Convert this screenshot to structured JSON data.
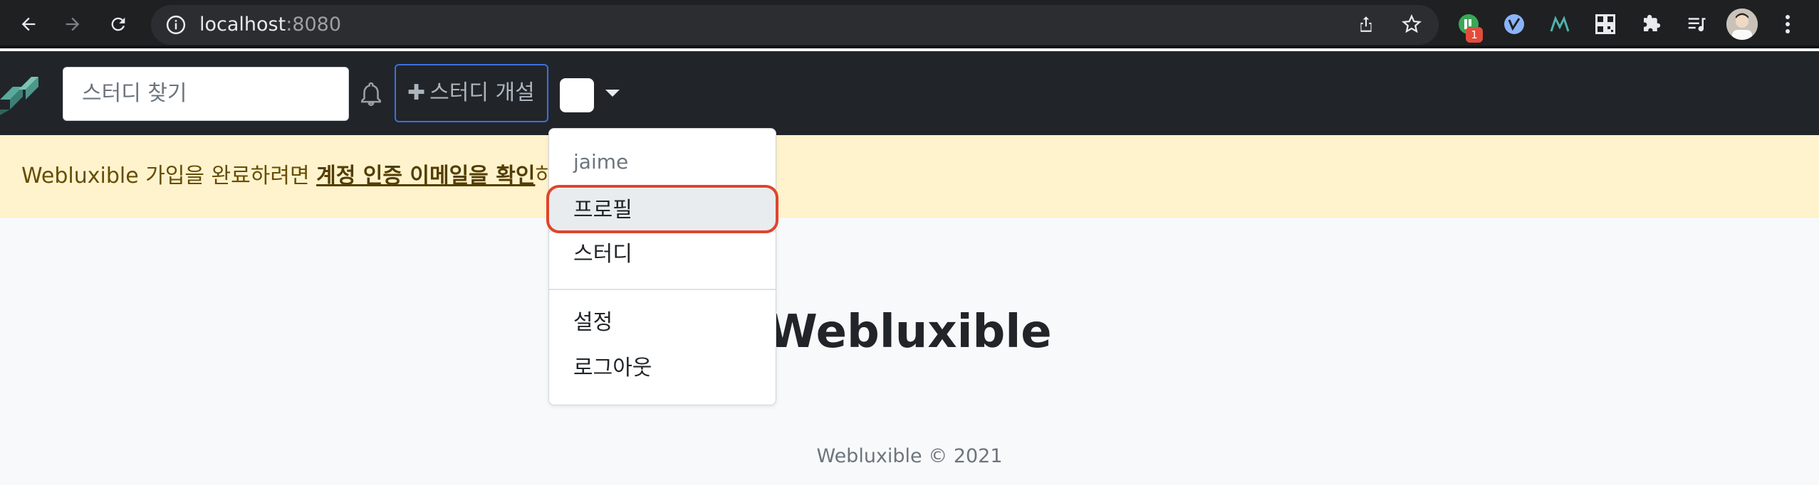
{
  "browser": {
    "url_host": "localhost",
    "url_port": ":8080",
    "extension_badge": "1"
  },
  "navbar": {
    "search_placeholder": "스터디 찾기",
    "open_study_label": "스터디 개설"
  },
  "alert": {
    "prefix": "Webluxible 가입을 완료하려면 ",
    "link": "계정 인증 이메일을 확인",
    "suffix": "하세요."
  },
  "dropdown": {
    "username": "jaime",
    "items": {
      "profile": "프로필",
      "study": "스터디",
      "settings": "설정",
      "logout": "로그아웃"
    }
  },
  "main": {
    "title": "Webluxible"
  },
  "footer": {
    "text": "Webluxible © 2021"
  },
  "colors": {
    "navbar_bg": "#212529",
    "alert_bg": "#fff3cd",
    "highlight": "#e0442c",
    "open_study_border": "#3d6fe0"
  }
}
